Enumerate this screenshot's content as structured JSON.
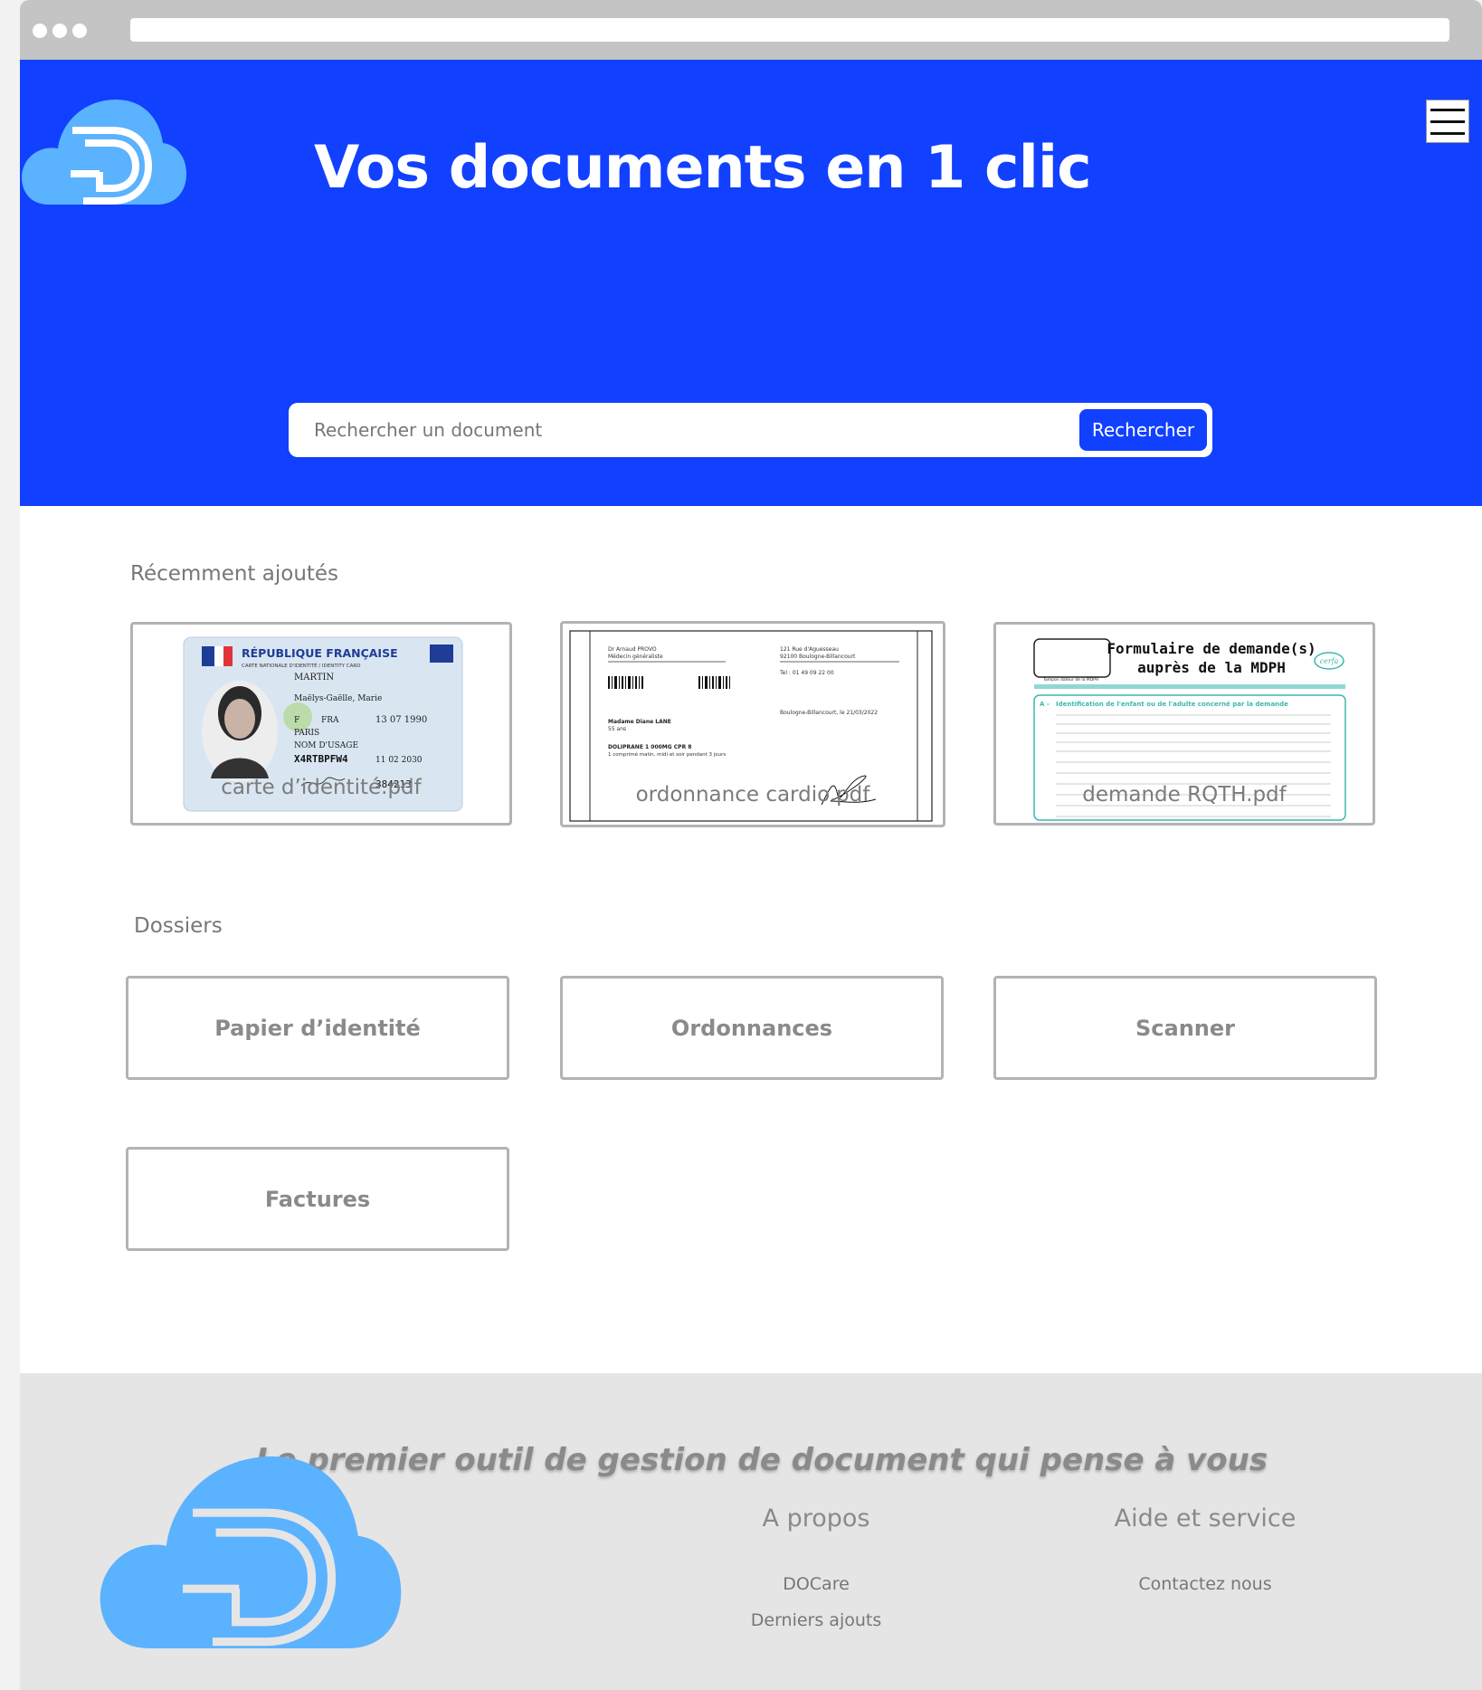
{
  "hero": {
    "title": "Vos documents en 1 clic",
    "search_placeholder": "Rechercher un document",
    "search_button": "Rechercher"
  },
  "recent": {
    "title": "Récemment ajoutés",
    "items": [
      {
        "name": "carte d’identité.pdf",
        "preview": {
          "header": "RÉPUBLIQUE FRANÇAISE",
          "subheader": "CARTE NATIONALE D'IDENTITÉ / IDENTITY CARD",
          "surname": "MARTIN",
          "given": "Maëlys-Gaëlle, Marie",
          "sex": "F",
          "nationality": "FRA",
          "birth": "13 07 1990",
          "place": "PARIS",
          "usage": "NOM D'USAGE",
          "doc_number": "X4RTBPFW4",
          "expiry": "11 02 2030",
          "code": "384213"
        }
      },
      {
        "name": "ordonnance cardio.pdf",
        "preview": {
          "doctor": "Dr Arnaud PROVO",
          "specialty": "Médecin généraliste",
          "address1": "121 Rue d'Aguesseau",
          "address2": "92100 Boulogne-Billancourt",
          "phone": "Tel : 01 49 09 22 00",
          "date": "Boulogne-Billancourt, le 21/03/2022",
          "patient": "Madame Diane LANE",
          "age": "55 ans",
          "drug": "DOLIPRANE 1 000MG CPR 8",
          "posology": "1 comprimé matin, midi et soir pendant 3 jours"
        }
      },
      {
        "name": "demande RQTH.pdf",
        "preview": {
          "title1": "Formulaire de demande(s)",
          "title2": "auprès de la MDPH",
          "section": "Identification de l'enfant ou de l'adulte concerné par la demande",
          "letter": "A -",
          "brand": "cerfa",
          "stamp": "Tampon dateur de la MDPH"
        }
      }
    ]
  },
  "folders": {
    "title": "Dossiers",
    "items": [
      "Papier d’identité",
      "Ordonnances",
      "Scanner",
      "Factures"
    ]
  },
  "footer": {
    "tagline": "Le  premier outil de gestion de document qui pense à vous",
    "col1": {
      "title": "A propos",
      "links": [
        "DOCare",
        "Derniers ajouts"
      ]
    },
    "col2": {
      "title": "Aide et service",
      "links": [
        "Contactez nous"
      ]
    }
  },
  "colors": {
    "primary": "#1140ff",
    "logo": "#5bb2ff",
    "footer_bg": "#e5e5e5"
  },
  "icons": {
    "logo": "cloud-d-logo-icon",
    "menu": "hamburger-menu-icon"
  }
}
